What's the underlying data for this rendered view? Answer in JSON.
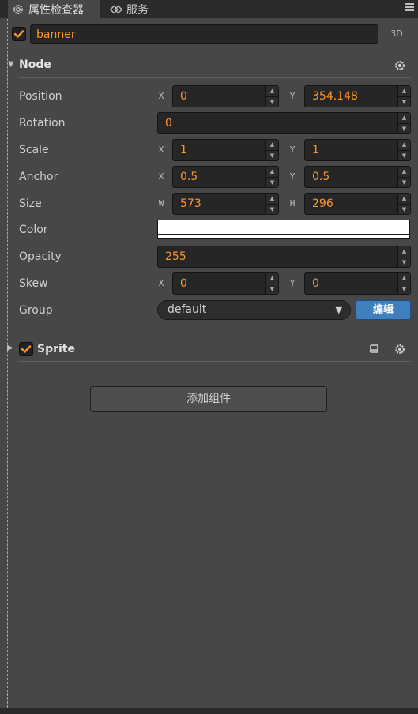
{
  "tabs": [
    {
      "label": "属性检查器",
      "icon": "gear-icon"
    },
    {
      "label": "服务",
      "icon": "link-icon"
    }
  ],
  "node_name": {
    "value": "banner",
    "checked": true
  },
  "mode_3d_label": "3D",
  "node_section": {
    "title": "Node"
  },
  "properties": {
    "position": {
      "label": "Position",
      "x_axis": "X",
      "x": "0",
      "y_axis": "Y",
      "y": "354.148"
    },
    "rotation": {
      "label": "Rotation",
      "value": "0"
    },
    "scale": {
      "label": "Scale",
      "x_axis": "X",
      "x": "1",
      "y_axis": "Y",
      "y": "1"
    },
    "anchor": {
      "label": "Anchor",
      "x_axis": "X",
      "x": "0.5",
      "y_axis": "Y",
      "y": "0.5"
    },
    "size": {
      "label": "Size",
      "w_axis": "W",
      "w": "573",
      "h_axis": "H",
      "h": "296"
    },
    "color": {
      "label": "Color",
      "value": "#ffffff"
    },
    "opacity": {
      "label": "Opacity",
      "value": "255"
    },
    "skew": {
      "label": "Skew",
      "x_axis": "X",
      "x": "0",
      "y_axis": "Y",
      "y": "0"
    },
    "group": {
      "label": "Group",
      "value": "default",
      "edit_label": "编辑"
    }
  },
  "sprite_section": {
    "title": "Sprite",
    "checked": true
  },
  "add_component_label": "添加组件",
  "colors": {
    "accent": "#fd942b",
    "panel": "#474747",
    "button_blue": "#3f7fbe"
  }
}
